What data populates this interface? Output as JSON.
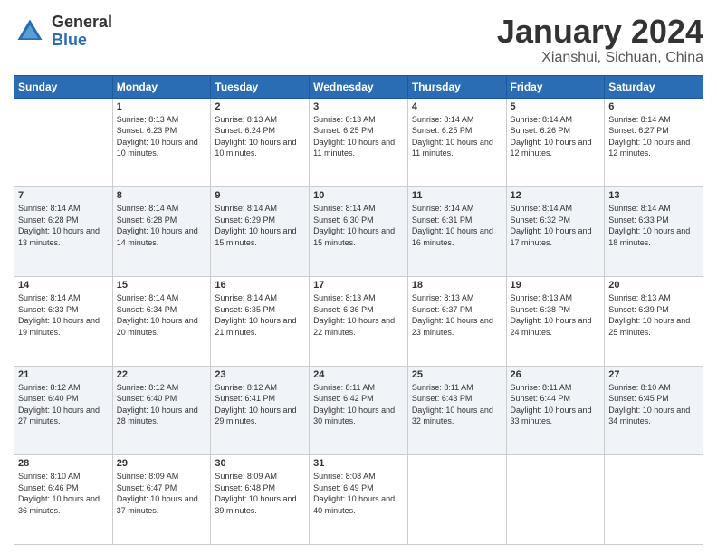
{
  "header": {
    "logo_general": "General",
    "logo_blue": "Blue",
    "title": "January 2024",
    "location": "Xianshui, Sichuan, China"
  },
  "columns": [
    "Sunday",
    "Monday",
    "Tuesday",
    "Wednesday",
    "Thursday",
    "Friday",
    "Saturday"
  ],
  "weeks": [
    {
      "days": [
        {
          "num": "",
          "sunrise": "",
          "sunset": "",
          "daylight": ""
        },
        {
          "num": "1",
          "sunrise": "Sunrise: 8:13 AM",
          "sunset": "Sunset: 6:23 PM",
          "daylight": "Daylight: 10 hours and 10 minutes."
        },
        {
          "num": "2",
          "sunrise": "Sunrise: 8:13 AM",
          "sunset": "Sunset: 6:24 PM",
          "daylight": "Daylight: 10 hours and 10 minutes."
        },
        {
          "num": "3",
          "sunrise": "Sunrise: 8:13 AM",
          "sunset": "Sunset: 6:25 PM",
          "daylight": "Daylight: 10 hours and 11 minutes."
        },
        {
          "num": "4",
          "sunrise": "Sunrise: 8:14 AM",
          "sunset": "Sunset: 6:25 PM",
          "daylight": "Daylight: 10 hours and 11 minutes."
        },
        {
          "num": "5",
          "sunrise": "Sunrise: 8:14 AM",
          "sunset": "Sunset: 6:26 PM",
          "daylight": "Daylight: 10 hours and 12 minutes."
        },
        {
          "num": "6",
          "sunrise": "Sunrise: 8:14 AM",
          "sunset": "Sunset: 6:27 PM",
          "daylight": "Daylight: 10 hours and 12 minutes."
        }
      ]
    },
    {
      "days": [
        {
          "num": "7",
          "sunrise": "Sunrise: 8:14 AM",
          "sunset": "Sunset: 6:28 PM",
          "daylight": "Daylight: 10 hours and 13 minutes."
        },
        {
          "num": "8",
          "sunrise": "Sunrise: 8:14 AM",
          "sunset": "Sunset: 6:28 PM",
          "daylight": "Daylight: 10 hours and 14 minutes."
        },
        {
          "num": "9",
          "sunrise": "Sunrise: 8:14 AM",
          "sunset": "Sunset: 6:29 PM",
          "daylight": "Daylight: 10 hours and 15 minutes."
        },
        {
          "num": "10",
          "sunrise": "Sunrise: 8:14 AM",
          "sunset": "Sunset: 6:30 PM",
          "daylight": "Daylight: 10 hours and 15 minutes."
        },
        {
          "num": "11",
          "sunrise": "Sunrise: 8:14 AM",
          "sunset": "Sunset: 6:31 PM",
          "daylight": "Daylight: 10 hours and 16 minutes."
        },
        {
          "num": "12",
          "sunrise": "Sunrise: 8:14 AM",
          "sunset": "Sunset: 6:32 PM",
          "daylight": "Daylight: 10 hours and 17 minutes."
        },
        {
          "num": "13",
          "sunrise": "Sunrise: 8:14 AM",
          "sunset": "Sunset: 6:33 PM",
          "daylight": "Daylight: 10 hours and 18 minutes."
        }
      ]
    },
    {
      "days": [
        {
          "num": "14",
          "sunrise": "Sunrise: 8:14 AM",
          "sunset": "Sunset: 6:33 PM",
          "daylight": "Daylight: 10 hours and 19 minutes."
        },
        {
          "num": "15",
          "sunrise": "Sunrise: 8:14 AM",
          "sunset": "Sunset: 6:34 PM",
          "daylight": "Daylight: 10 hours and 20 minutes."
        },
        {
          "num": "16",
          "sunrise": "Sunrise: 8:14 AM",
          "sunset": "Sunset: 6:35 PM",
          "daylight": "Daylight: 10 hours and 21 minutes."
        },
        {
          "num": "17",
          "sunrise": "Sunrise: 8:13 AM",
          "sunset": "Sunset: 6:36 PM",
          "daylight": "Daylight: 10 hours and 22 minutes."
        },
        {
          "num": "18",
          "sunrise": "Sunrise: 8:13 AM",
          "sunset": "Sunset: 6:37 PM",
          "daylight": "Daylight: 10 hours and 23 minutes."
        },
        {
          "num": "19",
          "sunrise": "Sunrise: 8:13 AM",
          "sunset": "Sunset: 6:38 PM",
          "daylight": "Daylight: 10 hours and 24 minutes."
        },
        {
          "num": "20",
          "sunrise": "Sunrise: 8:13 AM",
          "sunset": "Sunset: 6:39 PM",
          "daylight": "Daylight: 10 hours and 25 minutes."
        }
      ]
    },
    {
      "days": [
        {
          "num": "21",
          "sunrise": "Sunrise: 8:12 AM",
          "sunset": "Sunset: 6:40 PM",
          "daylight": "Daylight: 10 hours and 27 minutes."
        },
        {
          "num": "22",
          "sunrise": "Sunrise: 8:12 AM",
          "sunset": "Sunset: 6:40 PM",
          "daylight": "Daylight: 10 hours and 28 minutes."
        },
        {
          "num": "23",
          "sunrise": "Sunrise: 8:12 AM",
          "sunset": "Sunset: 6:41 PM",
          "daylight": "Daylight: 10 hours and 29 minutes."
        },
        {
          "num": "24",
          "sunrise": "Sunrise: 8:11 AM",
          "sunset": "Sunset: 6:42 PM",
          "daylight": "Daylight: 10 hours and 30 minutes."
        },
        {
          "num": "25",
          "sunrise": "Sunrise: 8:11 AM",
          "sunset": "Sunset: 6:43 PM",
          "daylight": "Daylight: 10 hours and 32 minutes."
        },
        {
          "num": "26",
          "sunrise": "Sunrise: 8:11 AM",
          "sunset": "Sunset: 6:44 PM",
          "daylight": "Daylight: 10 hours and 33 minutes."
        },
        {
          "num": "27",
          "sunrise": "Sunrise: 8:10 AM",
          "sunset": "Sunset: 6:45 PM",
          "daylight": "Daylight: 10 hours and 34 minutes."
        }
      ]
    },
    {
      "days": [
        {
          "num": "28",
          "sunrise": "Sunrise: 8:10 AM",
          "sunset": "Sunset: 6:46 PM",
          "daylight": "Daylight: 10 hours and 36 minutes."
        },
        {
          "num": "29",
          "sunrise": "Sunrise: 8:09 AM",
          "sunset": "Sunset: 6:47 PM",
          "daylight": "Daylight: 10 hours and 37 minutes."
        },
        {
          "num": "30",
          "sunrise": "Sunrise: 8:09 AM",
          "sunset": "Sunset: 6:48 PM",
          "daylight": "Daylight: 10 hours and 39 minutes."
        },
        {
          "num": "31",
          "sunrise": "Sunrise: 8:08 AM",
          "sunset": "Sunset: 6:49 PM",
          "daylight": "Daylight: 10 hours and 40 minutes."
        },
        {
          "num": "",
          "sunrise": "",
          "sunset": "",
          "daylight": ""
        },
        {
          "num": "",
          "sunrise": "",
          "sunset": "",
          "daylight": ""
        },
        {
          "num": "",
          "sunrise": "",
          "sunset": "",
          "daylight": ""
        }
      ]
    }
  ]
}
